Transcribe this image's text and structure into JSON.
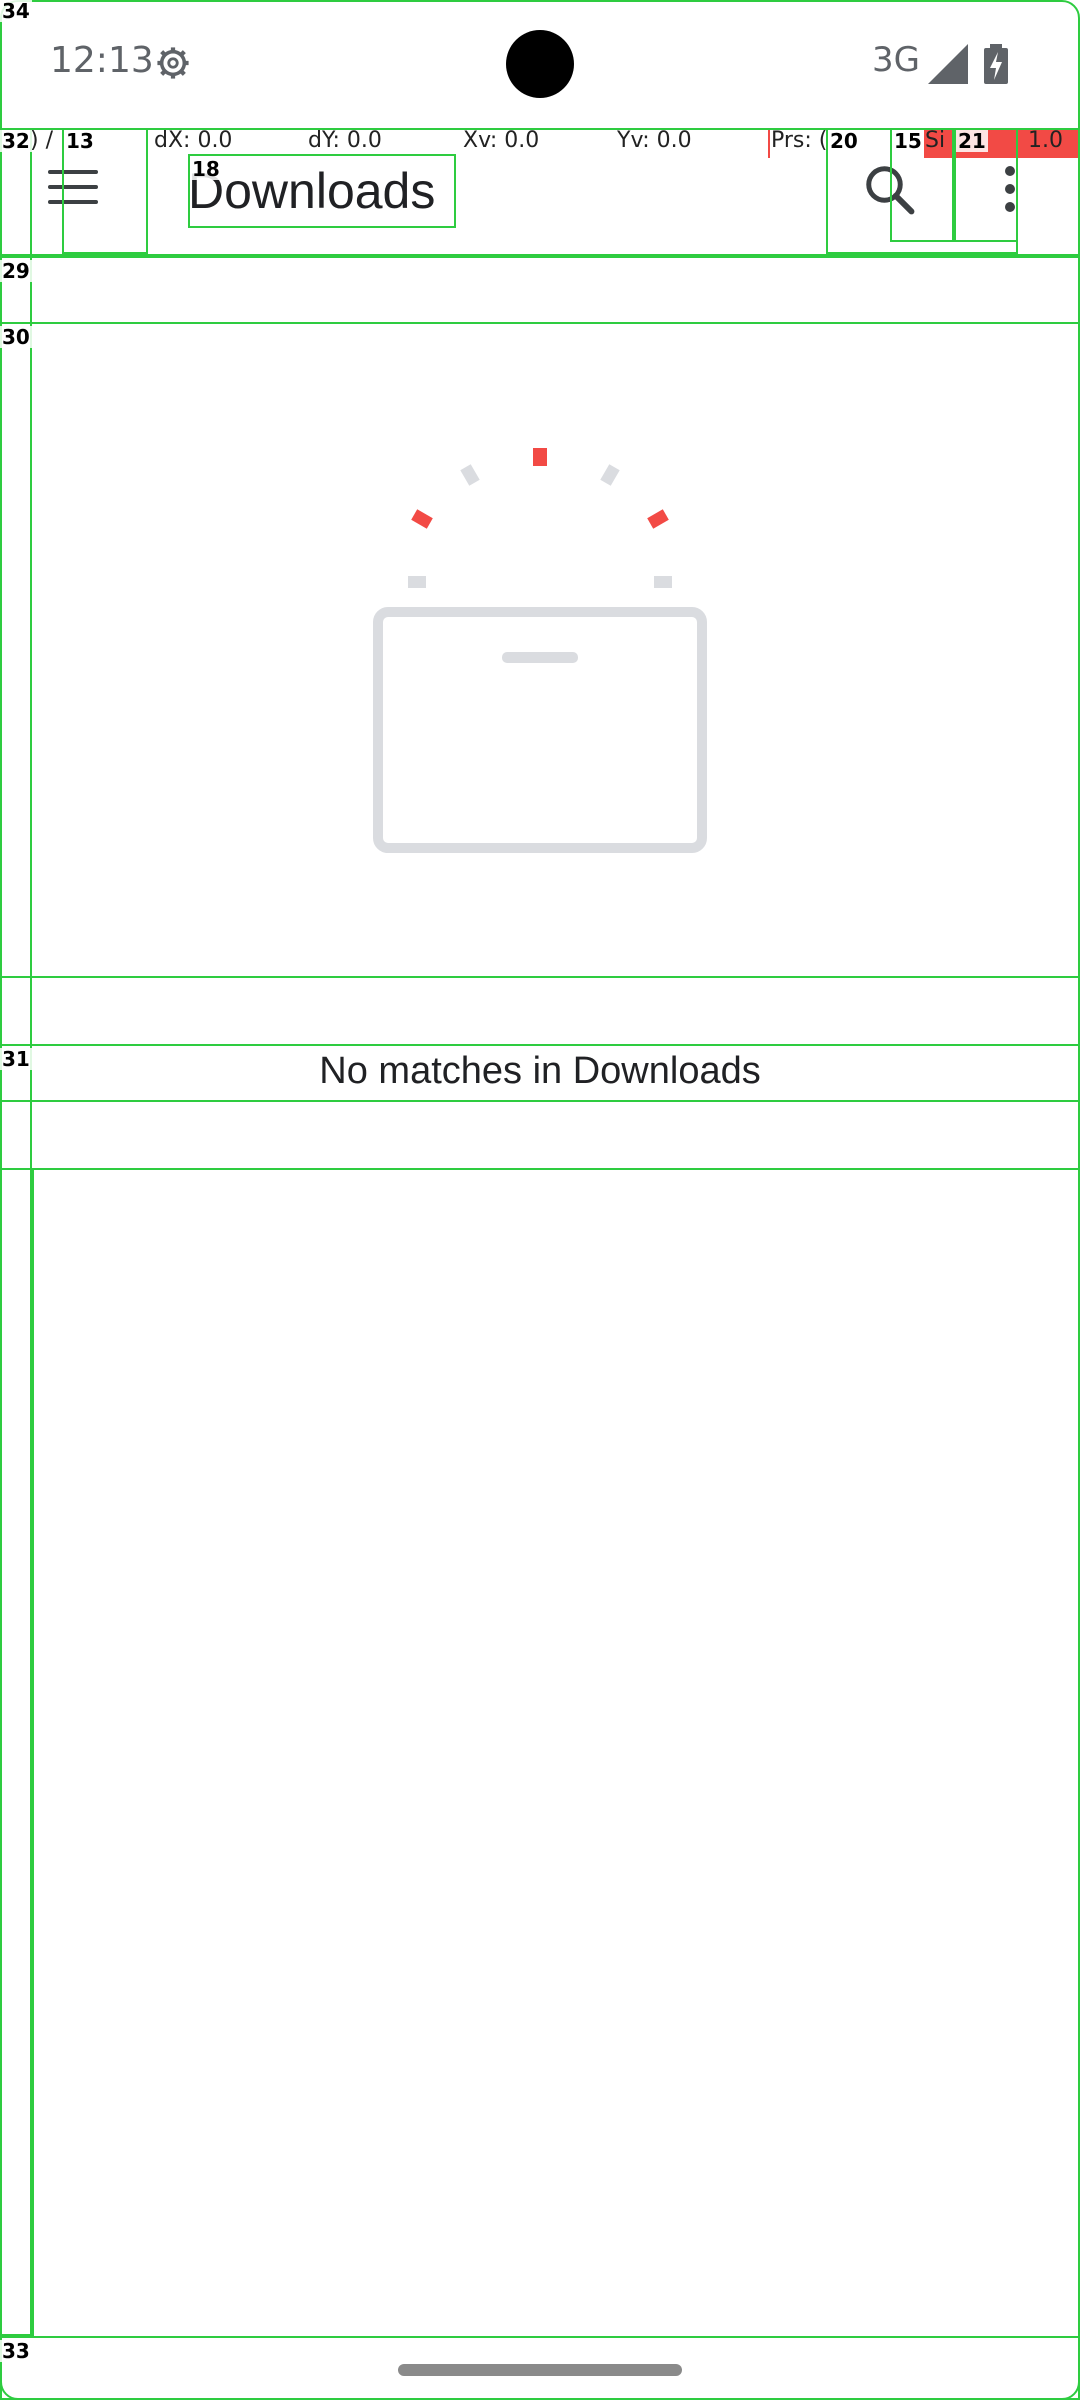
{
  "status_bar": {
    "time": "12:13",
    "network": "3G",
    "icons": [
      "settings-gear-icon",
      "cellular-signal-icon",
      "battery-charging-icon"
    ]
  },
  "pointer_overlay": {
    "p": ") /",
    "dx": "dX: 0.0",
    "dy": "dY: 0.0",
    "xv": "Xv: 0.0",
    "yv": "Yv: 0.0",
    "prs": "Prs: (",
    "size": "Si",
    "size_val": "1.0"
  },
  "app_bar": {
    "title": "Downloads",
    "icons": [
      "hamburger-menu-icon",
      "search-icon",
      "more-vert-icon"
    ]
  },
  "empty_state": {
    "message": "No matches in Downloads",
    "illustration": "empty-box-icon"
  },
  "debug_labels": {
    "l34": "34",
    "l32": "32",
    "l13": "13",
    "l18": "18",
    "l20": "20",
    "l15": "15",
    "l21": "21",
    "l29": "29",
    "l30": "30",
    "l31": "31",
    "l33": "33"
  },
  "colors": {
    "accent": "#f24a45",
    "debug_outline": "#2ecc40",
    "text_primary": "#202124",
    "text_secondary": "#5f6368"
  }
}
